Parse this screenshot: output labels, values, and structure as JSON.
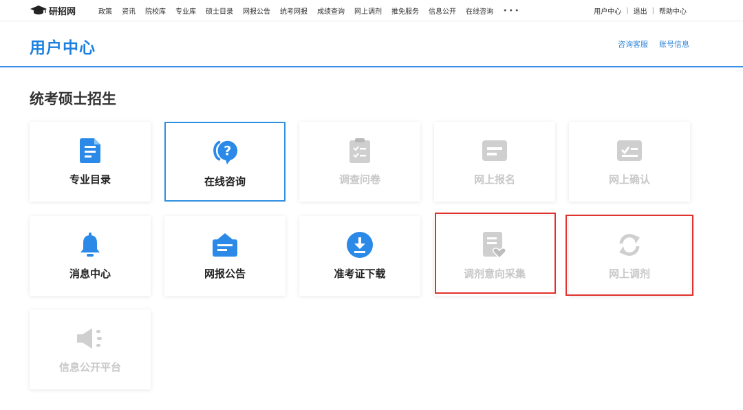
{
  "colors": {
    "primary": "#1c80e0",
    "disabled": "#c8c8c8",
    "highlight_red": "#e0322c"
  },
  "topnav": {
    "logo_text": "研招网",
    "items": [
      "政策",
      "资讯",
      "院校库",
      "专业库",
      "硕士目录",
      "网报公告",
      "统考网报",
      "成绩查询",
      "网上调剂",
      "推免服务",
      "信息公开",
      "在线咨询"
    ],
    "more": "•••",
    "right": {
      "user_center": "用户中心",
      "sep1": "|",
      "logout": "退出",
      "sep2": "|",
      "help": "帮助中心"
    }
  },
  "header": {
    "title": "用户中心",
    "links": [
      "咨询客服",
      "账号信息"
    ]
  },
  "section": {
    "title": "统考硕士招生"
  },
  "cards": [
    {
      "label": "专业目录",
      "icon": "document-list-icon",
      "state": "enabled"
    },
    {
      "label": "在线咨询",
      "icon": "question-chat-icon",
      "state": "selected"
    },
    {
      "label": "调查问卷",
      "icon": "clipboard-check-icon",
      "state": "disabled"
    },
    {
      "label": "网上报名",
      "icon": "form-card-icon",
      "state": "disabled"
    },
    {
      "label": "网上确认",
      "icon": "check-card-icon",
      "state": "disabled"
    },
    {
      "label": "消息中心",
      "icon": "bell-icon",
      "state": "enabled"
    },
    {
      "label": "网报公告",
      "icon": "bulletin-board-icon",
      "state": "enabled"
    },
    {
      "label": "准考证下载",
      "icon": "download-circle-icon",
      "state": "enabled"
    },
    {
      "label": "调剂意向采集",
      "icon": "document-heart-icon",
      "state": "disabled"
    },
    {
      "label": "网上调剂",
      "icon": "refresh-icon",
      "state": "disabled"
    },
    {
      "label": "信息公开平台",
      "icon": "speaker-icon",
      "state": "disabled"
    }
  ]
}
